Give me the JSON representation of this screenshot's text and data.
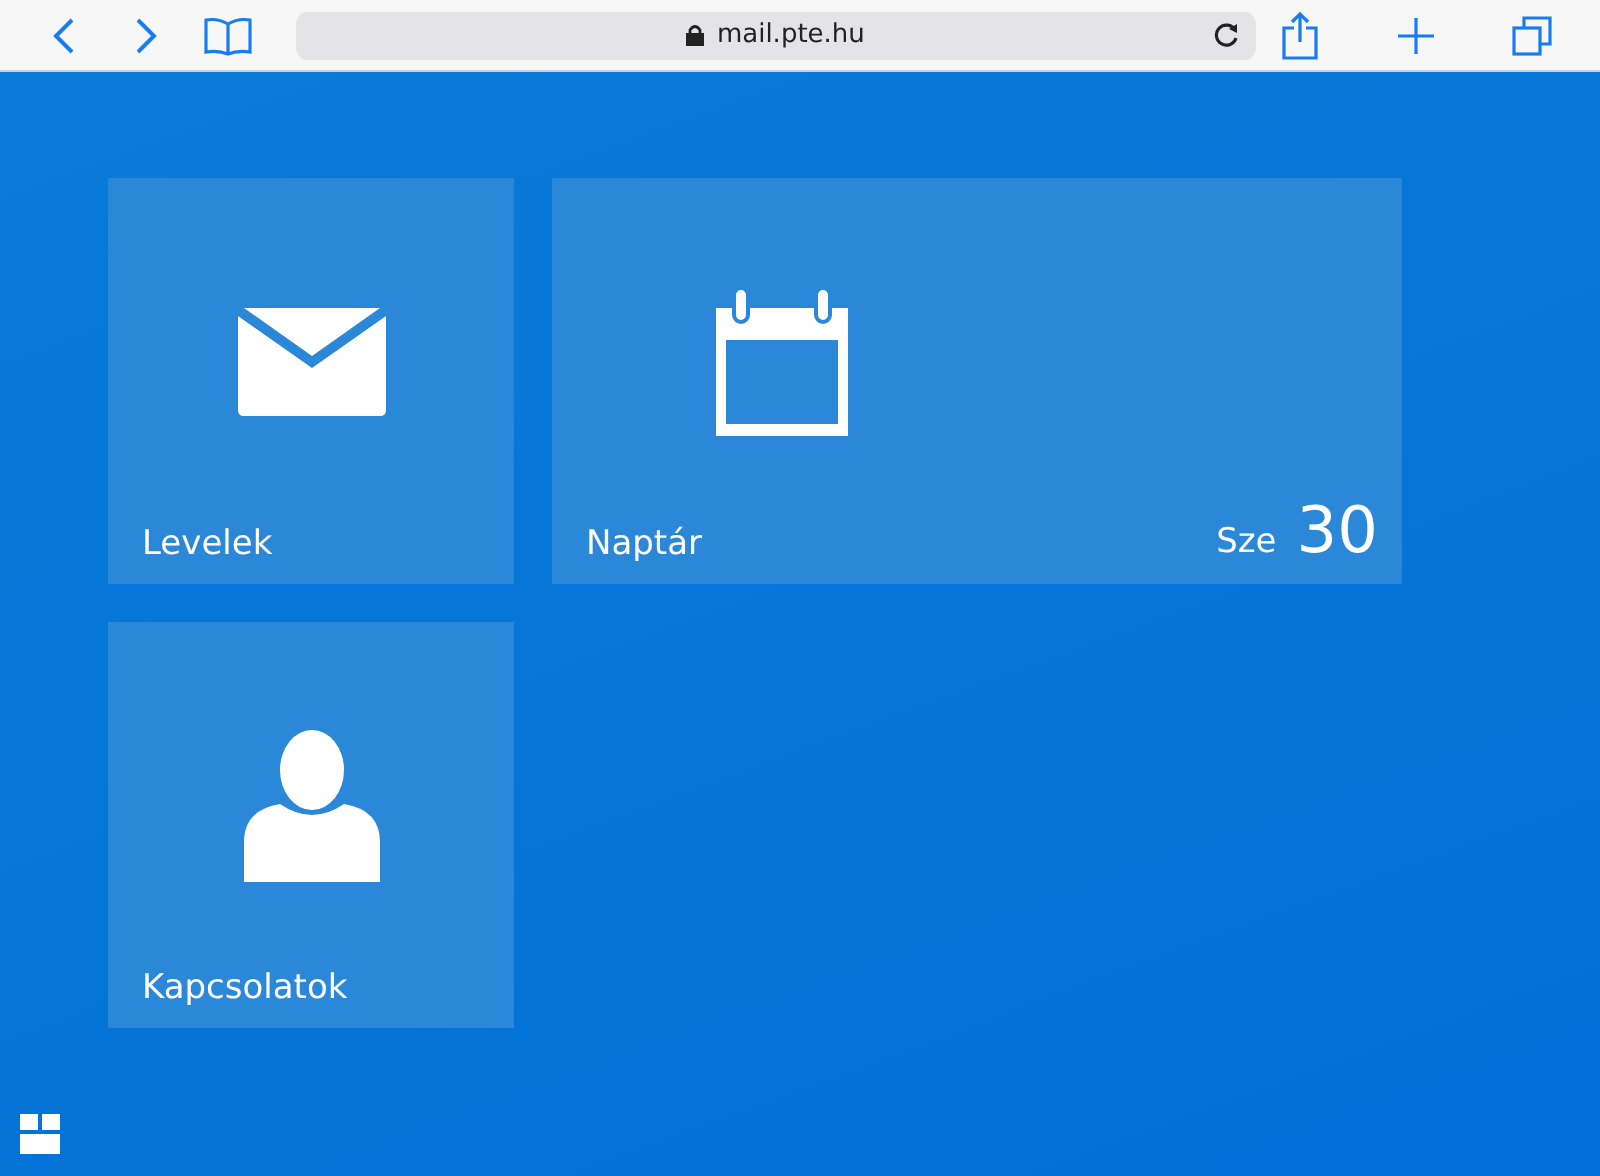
{
  "browser": {
    "address": "mail.pte.hu"
  },
  "tiles": [
    {
      "kind": "mail",
      "label": "Levelek"
    },
    {
      "kind": "calendar",
      "label": "Naptár",
      "month": "Sze",
      "day": "30"
    },
    {
      "kind": "contacts",
      "label": "Kapcsolatok"
    }
  ]
}
